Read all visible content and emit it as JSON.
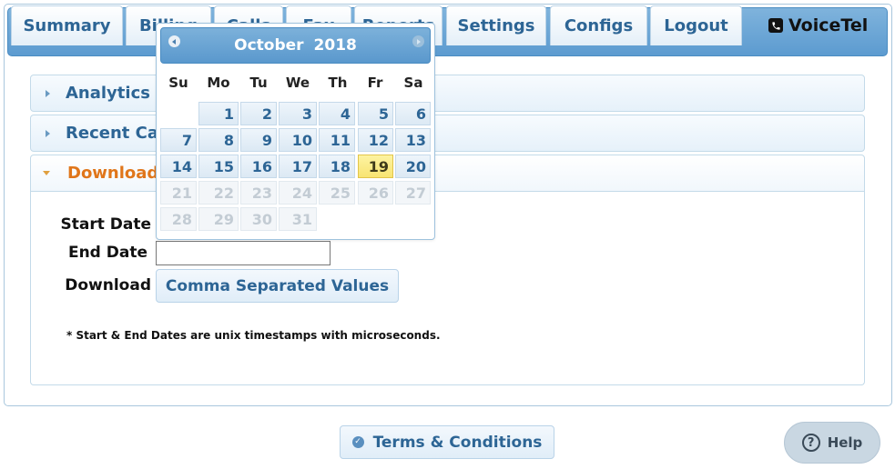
{
  "nav": {
    "tabs": [
      {
        "label": "Summary"
      },
      {
        "label": "Billing"
      },
      {
        "label": "Calls"
      },
      {
        "label": "Fax"
      },
      {
        "label": "Reports"
      },
      {
        "label": "Settings"
      },
      {
        "label": "Configs"
      },
      {
        "label": "Logout"
      }
    ],
    "brand": "VoiceTel",
    "brand_icon": "phone-icon"
  },
  "accordion": {
    "sections": [
      {
        "label": "Analytics"
      },
      {
        "label": "Recent Calls"
      },
      {
        "label": "Download Calls"
      }
    ],
    "active_index": 2
  },
  "download_form": {
    "start_label": "Start Date",
    "end_label": "End Date",
    "end_value": "",
    "download_label": "Download",
    "csv_button": "Comma Separated Values",
    "note": "* Start & End Dates are unix timestamps with microseconds."
  },
  "datepicker": {
    "month": "October",
    "year": "2018",
    "prev_icon": "prev-month-icon",
    "next_icon": "next-month-icon",
    "weekdays": [
      "Su",
      "Mo",
      "Tu",
      "We",
      "Th",
      "Fr",
      "Sa"
    ],
    "days": [
      "1",
      "2",
      "3",
      "4",
      "5",
      "6",
      "7",
      "8",
      "9",
      "10",
      "11",
      "12",
      "13",
      "14",
      "15",
      "16",
      "17",
      "18",
      "19",
      "20",
      "21",
      "22",
      "23",
      "24",
      "25",
      "26",
      "27",
      "28",
      "29",
      "30",
      "31"
    ],
    "first_weekday_index": 1,
    "today": 19,
    "disabled_from": 21,
    "highlight_color": "#f8e472"
  },
  "footer": {
    "terms": "Terms & Conditions",
    "terms_icon": "check-circle-icon",
    "help": "Help",
    "help_icon": "question-circle-icon"
  }
}
